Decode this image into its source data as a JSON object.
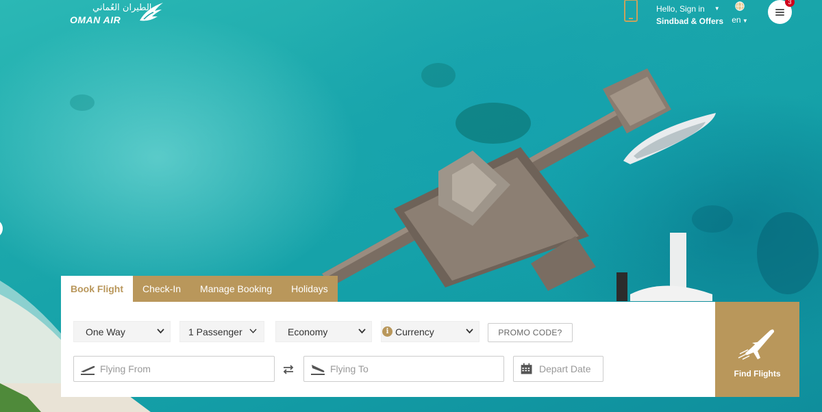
{
  "header": {
    "logo_arabic": "الطيران العُماني",
    "logo_english": "OMAN AIR",
    "hello_text": "Hello, Sign in",
    "offers_text": "Sindbad & Offers",
    "language": "en",
    "menu_badge": "3"
  },
  "tabs": [
    {
      "label": "Book Flight",
      "active": true
    },
    {
      "label": "Check-In",
      "active": false
    },
    {
      "label": "Manage Booking",
      "active": false
    },
    {
      "label": "Holidays",
      "active": false
    }
  ],
  "booking": {
    "trip_type": "One Way",
    "passengers": "1 Passenger",
    "cabin_class": "Economy",
    "currency": "Currency",
    "promo_code": "PROMO CODE?",
    "flying_from_placeholder": "Flying From",
    "flying_to_placeholder": "Flying To",
    "depart_date_placeholder": "Depart Date",
    "find_flights": "Find Flights"
  },
  "colors": {
    "brand_gold": "#b9975b",
    "badge_red": "#d0021b",
    "sea": "#1aa3a6"
  },
  "icons": [
    "oman-air-logo-icon",
    "phone-icon",
    "globe-icon",
    "menu-icon",
    "info-icon",
    "takeoff-icon",
    "swap-icon",
    "landing-icon",
    "calendar-icon",
    "airplane-icon",
    "chevron-down-icon"
  ]
}
